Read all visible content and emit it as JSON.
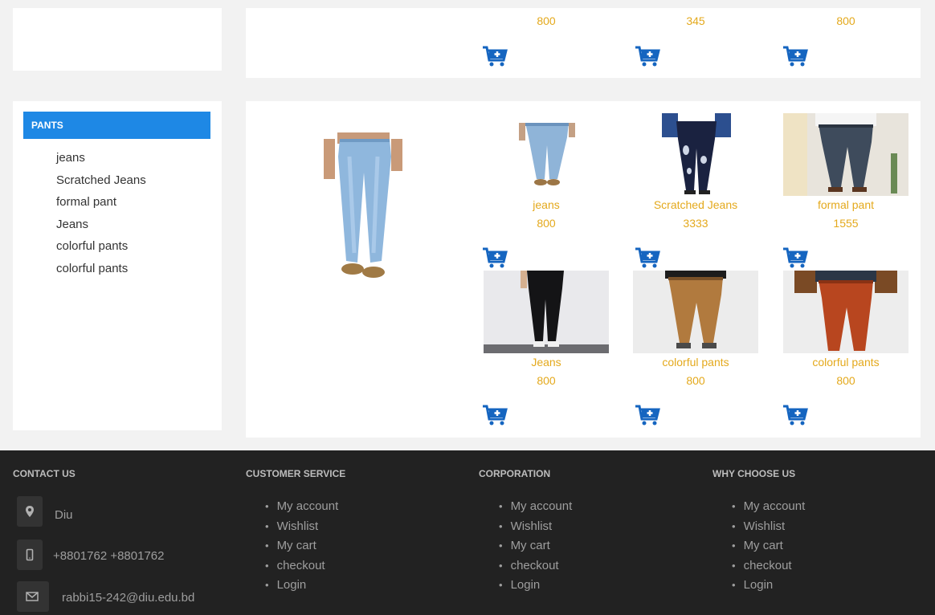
{
  "top_row": {
    "prices": [
      "800",
      "345",
      "800"
    ]
  },
  "sidebar": {
    "header": "PANTS",
    "items": [
      "jeans",
      "Scratched Jeans",
      "formal pant",
      "Jeans",
      "colorful pants",
      "colorful pants"
    ]
  },
  "products": [
    {
      "name": "jeans",
      "price": "800"
    },
    {
      "name": "Scratched Jeans",
      "price": "3333"
    },
    {
      "name": "formal pant",
      "price": "1555"
    },
    {
      "name": "Jeans",
      "price": "800"
    },
    {
      "name": "colorful pants",
      "price": "800"
    },
    {
      "name": "colorful pants",
      "price": "800"
    }
  ],
  "footer": {
    "contact": {
      "title": "CONTACT US",
      "address": "Diu",
      "phone": "+8801762 +8801762",
      "email": "rabbi15-242@diu.edu.bd"
    },
    "customer_service": {
      "title": "CUSTOMER SERVICE",
      "links": [
        "My account",
        "Wishlist",
        "My cart",
        "checkout",
        "Login"
      ]
    },
    "corporation": {
      "title": "CORPORATION",
      "links": [
        "My account",
        "Wishlist",
        "My cart",
        "checkout",
        "Login"
      ]
    },
    "why_choose_us": {
      "title": "WHY CHOOSE US",
      "links": [
        "My account",
        "Wishlist",
        "My cart",
        "checkout",
        "Login"
      ]
    }
  },
  "colors": {
    "accent": "#1e88e5",
    "price": "#e4a91c",
    "cart": "#1565c0",
    "footer_bg": "#222222"
  }
}
